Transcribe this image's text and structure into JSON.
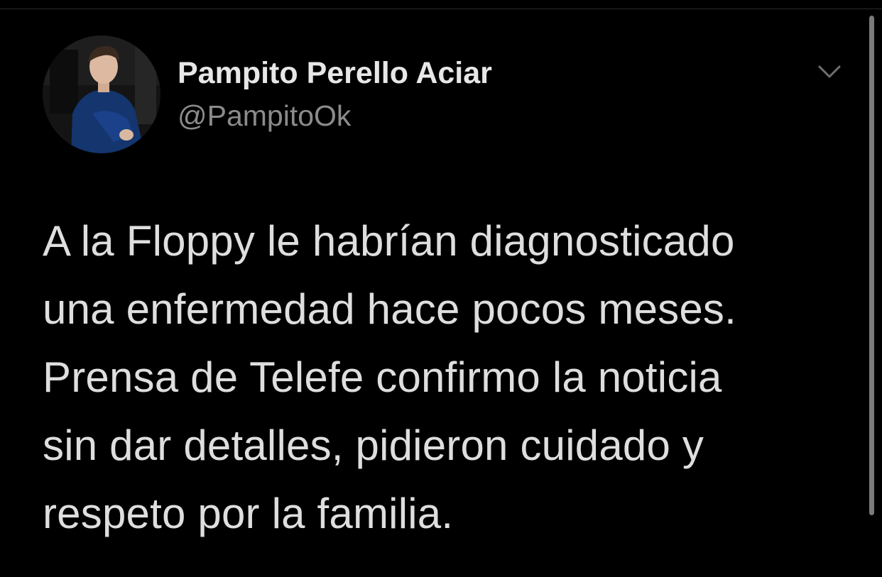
{
  "tweet": {
    "author": {
      "display_name": "Pampito Perello Aciar",
      "handle": "@PampitoOk",
      "avatar_icon": "user-avatar-photo"
    },
    "more_icon": "chevron-down-icon",
    "text_lines": [
      "A la Floppy le habrían diagnosticado",
      "una enfermedad hace pocos meses.",
      "Prensa de Telefe confirmo la noticia",
      "sin dar detalles, pidieron cuidado y",
      "respeto por la familia."
    ]
  },
  "colors": {
    "background": "#000000",
    "name": "#e7e7e7",
    "handle": "#8b8b8b",
    "body_text": "#dedede"
  }
}
